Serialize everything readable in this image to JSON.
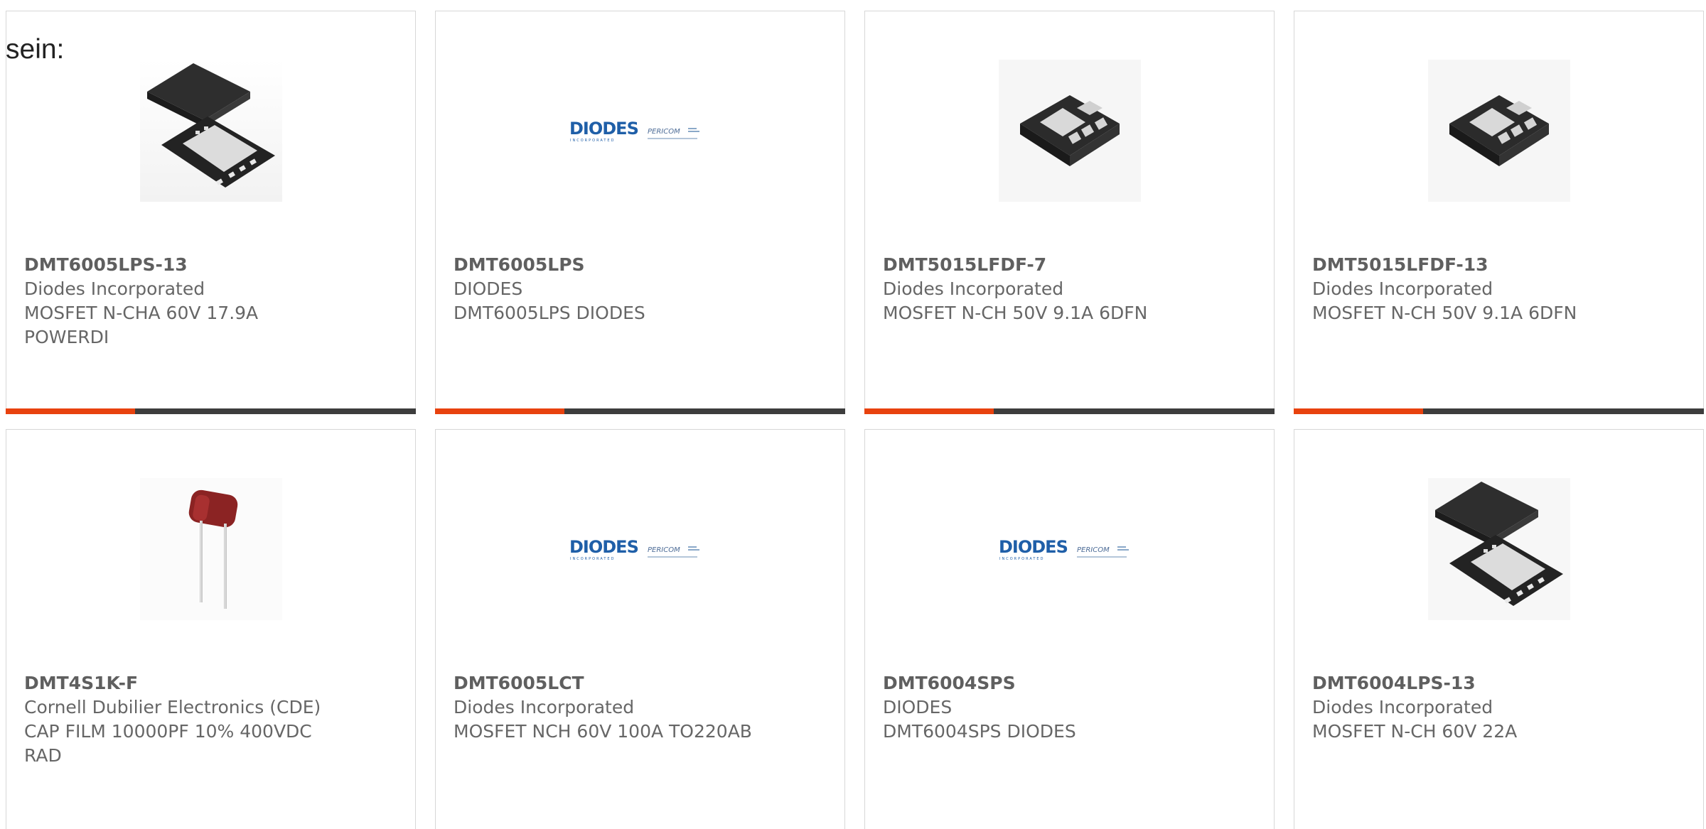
{
  "leading_text": "sein:",
  "colors": {
    "accent": "#e8420e",
    "bar": "#3d3d3d",
    "text": "#666666",
    "border": "#d7d7d7"
  },
  "products": [
    {
      "part_number": "DMT6005LPS-13",
      "manufacturer": "Diodes Incorporated",
      "description": "MOSFET N-CHA 60V 17.9A POWERDI",
      "image": "powerdi-package-image"
    },
    {
      "part_number": "DMT6005LPS",
      "manufacturer": "DIODES",
      "description": "DMT6005LPS DIODES",
      "image": "diodes-pericom-logo-image",
      "logo_text": "DIODES",
      "logo_sub": "INCORPORATED",
      "logo_partner": "PERICOM"
    },
    {
      "part_number": "DMT5015LFDF-7",
      "manufacturer": "Diodes Incorporated",
      "description": "MOSFET N-CH 50V 9.1A 6DFN",
      "image": "dfn-package-image"
    },
    {
      "part_number": "DMT5015LFDF-13",
      "manufacturer": "Diodes Incorporated",
      "description": "MOSFET N-CH 50V 9.1A 6DFN",
      "image": "dfn-package-image"
    },
    {
      "part_number": "DMT4S1K-F",
      "manufacturer": "Cornell Dubilier Electronics (CDE)",
      "description": "CAP FILM 10000PF 10% 400VDC RAD",
      "image": "film-capacitor-image"
    },
    {
      "part_number": "DMT6005LCT",
      "manufacturer": "Diodes Incorporated",
      "description": "MOSFET NCH 60V 100A TO220AB",
      "image": "diodes-pericom-logo-image",
      "logo_text": "DIODES",
      "logo_sub": "INCORPORATED",
      "logo_partner": "PERICOM"
    },
    {
      "part_number": "DMT6004SPS",
      "manufacturer": "DIODES",
      "description": "DMT6004SPS DIODES",
      "image": "diodes-pericom-logo-image",
      "logo_text": "DIODES",
      "logo_sub": "INCORPORATED",
      "logo_partner": "PERICOM"
    },
    {
      "part_number": "DMT6004LPS-13",
      "manufacturer": "Diodes Incorporated",
      "description": "MOSFET N-CH 60V 22A",
      "image": "powerdi-package-image"
    }
  ]
}
